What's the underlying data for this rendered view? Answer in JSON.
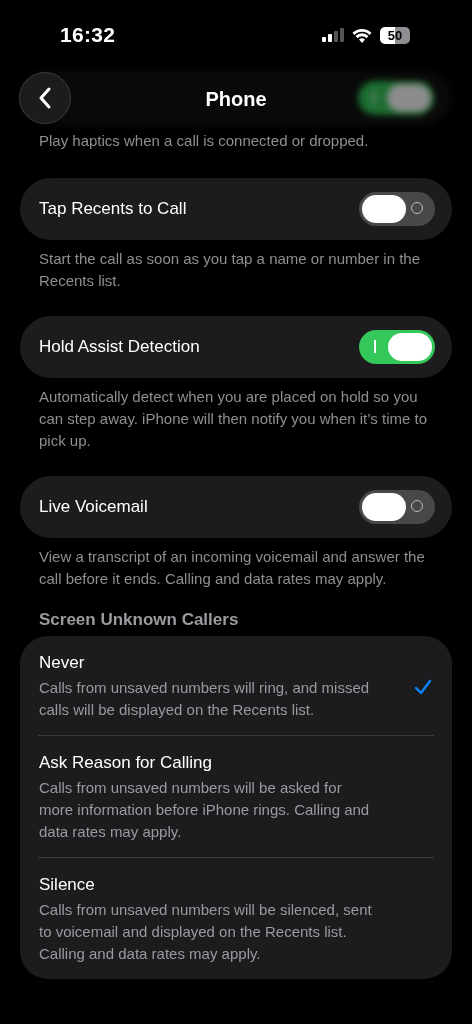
{
  "status_bar": {
    "time": "16:32",
    "battery": "50"
  },
  "header": {
    "title": "Phone"
  },
  "hidden_row": {
    "on": true,
    "footer": "Play haptics when a call is connected or dropped."
  },
  "settings": [
    {
      "label": "Tap Recents to Call",
      "on": false,
      "footer": "Start the call as soon as you tap a name or number in the Recents list."
    },
    {
      "label": "Hold Assist Detection",
      "on": true,
      "footer": "Automatically detect when you are placed on hold so you can step away. iPhone will then notify you when it’s time to pick up."
    },
    {
      "label": "Live Voicemail",
      "on": false,
      "footer": "View a transcript of an incoming voicemail and answer the call before it ends. Calling and data rates may apply."
    }
  ],
  "screen_unknown_callers": {
    "heading": "Screen Unknown Callers",
    "options": [
      {
        "title": "Never",
        "description": "Calls from unsaved numbers will ring, and missed calls will be displayed on the Recents list.",
        "selected": true
      },
      {
        "title": "Ask Reason for Calling",
        "description": "Calls from unsaved numbers will be asked for more information before iPhone rings. Calling and data rates may apply.",
        "selected": false
      },
      {
        "title": "Silence",
        "description": "Calls from unsaved numbers will be silenced, sent to voicemail and displayed on the Recents list. Calling and data rates may apply.",
        "selected": false
      }
    ]
  }
}
